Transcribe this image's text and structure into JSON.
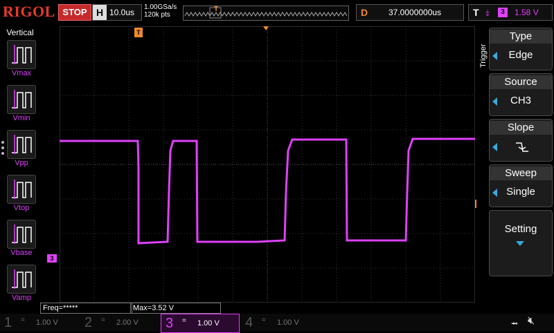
{
  "topbar": {
    "logo": "RIGOL",
    "run_state": "STOP",
    "h_label": "H",
    "timebase": "10.0us",
    "sample_rate": "1.00GSa/s",
    "mem_depth": "120k pts",
    "d_label": "D",
    "delay": "37.0000000us",
    "t_label": "T",
    "trig_source_num": "3",
    "trig_level": "1.58 V"
  },
  "left_panel": {
    "title": "Vertical",
    "items": [
      {
        "label": "Vmax",
        "icon": "vmax-icon"
      },
      {
        "label": "Vmin",
        "icon": "vmin-icon"
      },
      {
        "label": "Vpp",
        "icon": "vpp-icon"
      },
      {
        "label": "Vtop",
        "icon": "vtop-icon"
      },
      {
        "label": "Vbase",
        "icon": "vbase-icon"
      },
      {
        "label": "Vamp",
        "icon": "vamp-icon"
      }
    ]
  },
  "right_menu": {
    "title": "Trigger",
    "items": [
      {
        "title": "Type",
        "value": "Edge"
      },
      {
        "title": "Source",
        "value": "CH3"
      },
      {
        "title": "Slope",
        "value": ""
      },
      {
        "title": "Sweep",
        "value": "Single"
      },
      {
        "title": "",
        "value": "Setting"
      }
    ]
  },
  "markers": {
    "trigger_pos": "T",
    "trigger_level": "T",
    "ch3_ground": "3"
  },
  "measurements": {
    "freq": "Freq=*****",
    "max": "Max=3.52 V"
  },
  "channels": [
    {
      "num": "1",
      "coupling": "=",
      "scale": "1.00 V"
    },
    {
      "num": "2",
      "coupling": "=",
      "scale": "2.00 V"
    },
    {
      "num": "3",
      "coupling": "=",
      "scale": "1.00 V"
    },
    {
      "num": "4",
      "coupling": "=",
      "scale": "1.00 V"
    }
  ],
  "colors": {
    "ch3": "#e040fb",
    "trigger": "#f0882a",
    "accent": "#39a9e0",
    "stop": "#c62a2a"
  }
}
